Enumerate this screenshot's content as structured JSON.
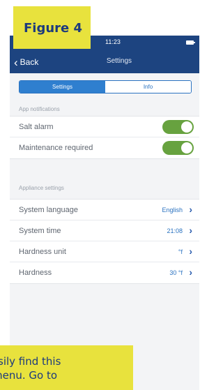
{
  "figure": {
    "label": "Figure 4"
  },
  "status_bar": {
    "time": "11:23",
    "battery_icon": "battery-icon"
  },
  "nav": {
    "back_label": "Back",
    "back_icon": "chevron-left-icon",
    "title": "Settings"
  },
  "tabs": [
    {
      "label": "Settings",
      "active": true
    },
    {
      "label": "Info",
      "active": false
    }
  ],
  "sections": {
    "app_notifications": {
      "header": "App notifications",
      "items": [
        {
          "label": "Salt alarm",
          "toggle_on": true
        },
        {
          "label": "Maintenance required",
          "toggle_on": true
        }
      ]
    },
    "appliance_settings": {
      "header": "Appliance settings",
      "items": [
        {
          "label": "System language",
          "value": "English"
        },
        {
          "label": "System time",
          "value": "21:08"
        },
        {
          "label": "Hardness unit",
          "value": "°f"
        },
        {
          "label": "Hardness",
          "value": "30 °f"
        }
      ]
    }
  },
  "caption": {
    "line1": "sily find this",
    "line2": "menu. Go to"
  },
  "colors": {
    "nav_bar": "#1d4480",
    "accent": "#2f7fcf",
    "toggle_on": "#67a23f",
    "highlight": "#e8e23d"
  }
}
